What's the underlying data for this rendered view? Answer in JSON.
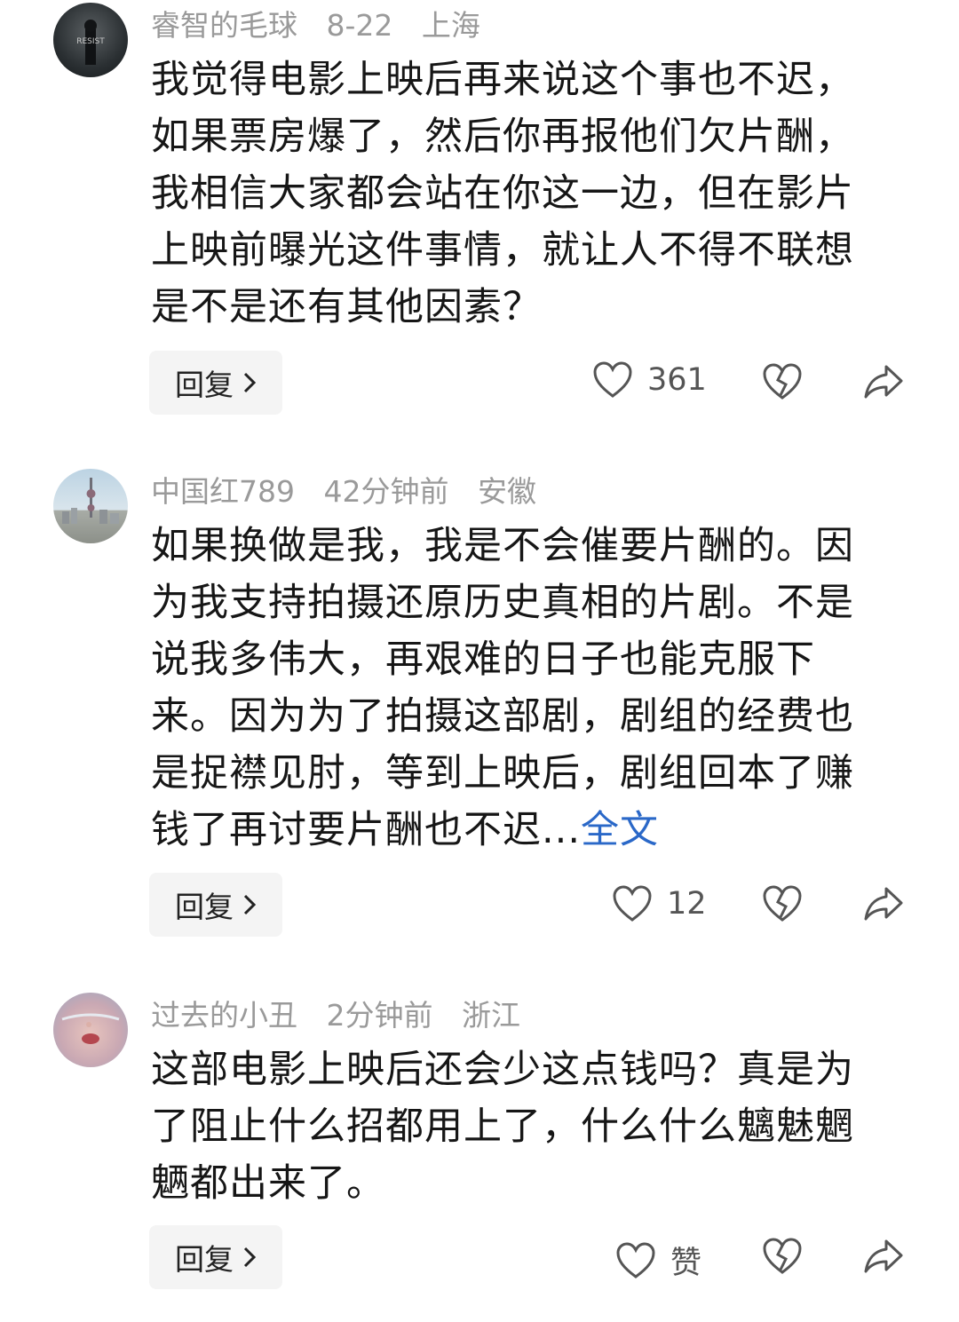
{
  "comments": [
    {
      "username": "睿智的毛球",
      "time": "8-22",
      "location": "上海",
      "text": "我觉得电影上映后再来说这个事也不迟，如果票房爆了，然后你再报他们欠片酬，我相信大家都会站在你这一边，但在影片上映前曝光这件事情，就让人不得不联想是不是还有其他因素？",
      "expand_label": "",
      "avatar_text": "RESIST",
      "reply_label": "回复",
      "like_count": "361"
    },
    {
      "username": "中国红789",
      "time": "42分钟前",
      "location": "安徽",
      "text": "如果换做是我，我是不会催要片酬的。因为我支持拍摄还原历史真相的片剧。不是说我多伟大，再艰难的日子也能克服下来。因为为了拍摄这部剧，剧组的经费也是捉襟见肘，等到上映后，剧组回本了赚钱了再讨要片酬也不迟...",
      "expand_label": "全文",
      "avatar_text": "",
      "reply_label": "回复",
      "like_count": "12"
    },
    {
      "username": "过去的小丑",
      "time": "2分钟前",
      "location": "浙江",
      "text": "这部电影上映后还会少这点钱吗？真是为了阻止什么招都用上了，什么什么魑魅魍魉都出来了。",
      "expand_label": "",
      "avatar_text": "",
      "reply_label": "回复",
      "like_count": "赞"
    }
  ],
  "icons": {
    "like": "heart-outline-icon",
    "dislike": "broken-heart-icon",
    "share": "share-arrow-icon",
    "chevron": "chevron-right-icon"
  },
  "colors": {
    "link": "#2a68c8",
    "meta": "#9a9a9a",
    "button_bg": "#f4f4f4"
  }
}
